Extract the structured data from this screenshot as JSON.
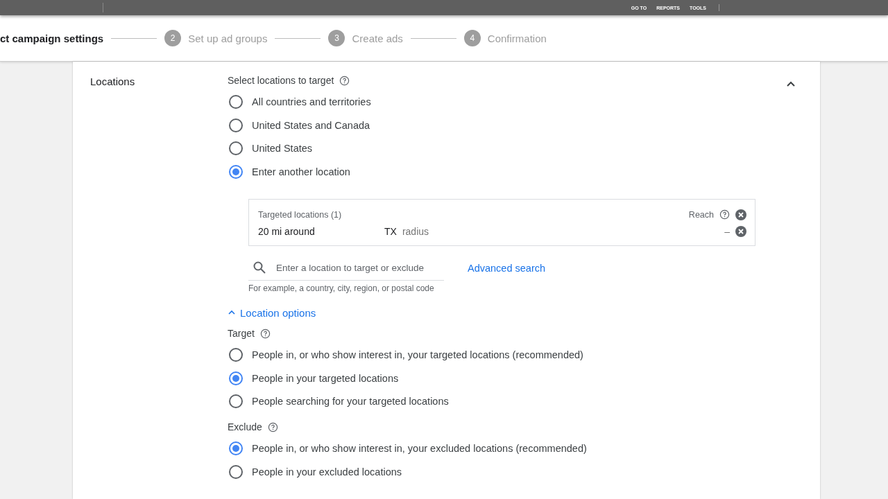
{
  "top_bar": {
    "nav": [
      "GO TO",
      "REPORTS",
      "TOOLS"
    ]
  },
  "steps": [
    {
      "label": "ct campaign settings",
      "selected": true
    },
    {
      "number": "2",
      "label": "Set up ad groups",
      "selected": false
    },
    {
      "number": "3",
      "label": "Create ads",
      "selected": false
    },
    {
      "number": "4",
      "label": "Confirmation",
      "selected": false
    }
  ],
  "section": {
    "title": "Locations",
    "expanded": true,
    "target_heading": "Select locations to target",
    "location_choices": [
      {
        "label": "All countries and territories",
        "selected": false
      },
      {
        "label": "United States and Canada",
        "selected": false
      },
      {
        "label": "United States",
        "selected": false
      },
      {
        "label": "Enter another location",
        "selected": true
      }
    ],
    "targeted": {
      "title": "Targeted locations (1)",
      "reach_label": "Reach",
      "items": [
        {
          "name": "20 mi around",
          "place": "TX",
          "type": "radius",
          "reach": "–"
        }
      ]
    },
    "search": {
      "placeholder": "Enter a location to target or exclude",
      "hint": "For example, a country, city, region, or postal code",
      "advanced_link": "Advanced search"
    },
    "options_toggle": {
      "label": "Location options",
      "expanded": true
    },
    "target": {
      "heading": "Target",
      "choices": [
        {
          "label": "People in, or who show interest in, your targeted locations (recommended)",
          "selected": false
        },
        {
          "label": "People in your targeted locations",
          "selected": true
        },
        {
          "label": "People searching for your targeted locations",
          "selected": false
        }
      ]
    },
    "exclude": {
      "heading": "Exclude",
      "choices": [
        {
          "label": "People in, or who show interest in, your excluded locations (recommended)",
          "selected": true
        },
        {
          "label": "People in your excluded locations",
          "selected": false
        }
      ]
    }
  }
}
